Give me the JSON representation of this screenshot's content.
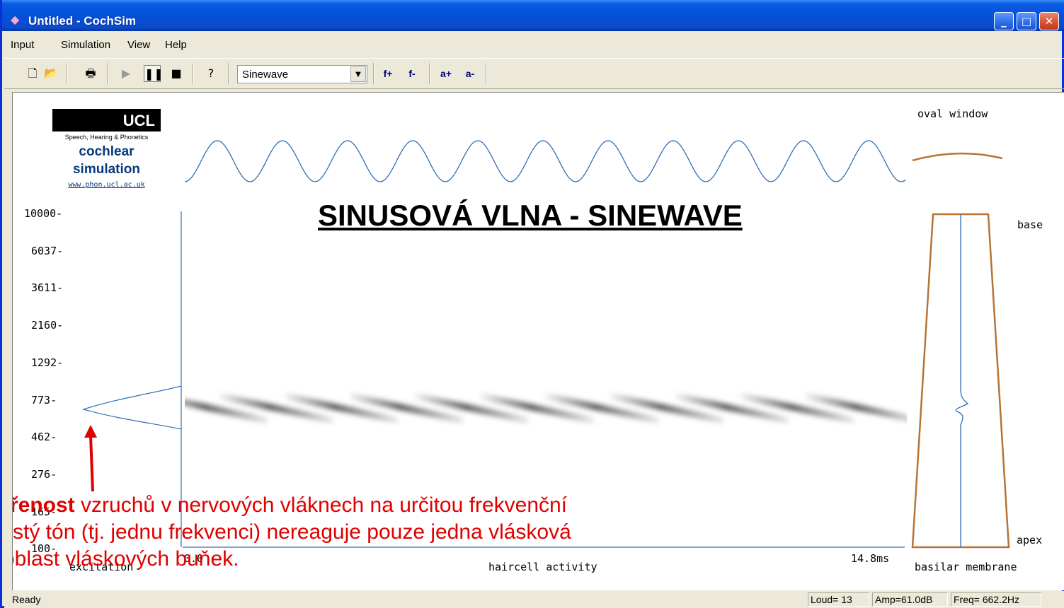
{
  "window": {
    "title": "Untitled - CochSim",
    "buttons": {
      "minimize": "_",
      "maximize": "□",
      "close": "✕"
    }
  },
  "menu": [
    "Input",
    "Simulation",
    "View",
    "Help"
  ],
  "toolbar": {
    "icons": [
      "new-file-icon",
      "open-folder-icon",
      "print-icon",
      "play-icon",
      "pause-icon",
      "stop-icon",
      "help-icon"
    ],
    "signal_select": "Sinewave",
    "freq_up": "f+",
    "freq_down": "f-",
    "amp_up": "a+",
    "amp_down": "a-"
  },
  "logo": {
    "brand": "UCL",
    "subtitle": "Speech, Hearing & Phonetics",
    "line1": "cochlear",
    "line2": "simulation",
    "url": "www.phon.ucl.ac.uk"
  },
  "display": {
    "oval_window_label": "oval window",
    "base_label": "base",
    "apex_label": "apex",
    "excitation_label": "excitation",
    "haircell_label": "haircell activity",
    "basilar_label": "basilar membrane",
    "time_start": "0.0",
    "time_end": "14.8ms",
    "freq_ticks": [
      "10000-",
      "6037-",
      "3611-",
      "2160-",
      "1292-",
      "773-",
      "462-",
      "276-",
      "165-",
      "100-"
    ],
    "sine_color": "#2F6DB5",
    "membrane_color": "#B87333",
    "oval_window_color": "#B87333"
  },
  "overlay": {
    "title": "SINUSOVÁ VLNA - SINEWAVE",
    "line1_bold": "třenost",
    "line1_rest": " vzruchů v nervových vláknech na určitou frekvenční",
    "line2": "stý tón (tj. jednu frekvenci) nereaguje pouze jedna vlásková",
    "line3": "oblast vláskových buňek.",
    "arrow_color": "#E00000"
  },
  "status": {
    "ready": "Ready",
    "loud": "Loud= 13",
    "amp": "Amp=61.0dB",
    "freq": "Freq= 662.2Hz"
  }
}
